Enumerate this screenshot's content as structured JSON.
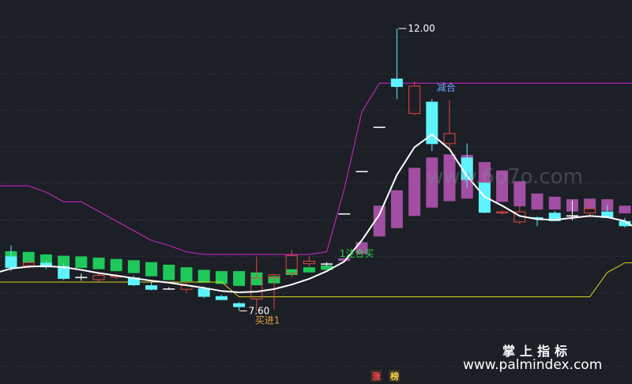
{
  "chart_data": {
    "type": "candlestick",
    "ylim": [
      7.2,
      12.1
    ],
    "grid": true,
    "candles": [
      {
        "o": 8.45,
        "h": 8.62,
        "l": 8.22,
        "c": 8.27
      },
      {
        "o": 8.3,
        "h": 8.4,
        "l": 8.26,
        "c": 8.36
      },
      {
        "o": 8.35,
        "h": 8.38,
        "l": 8.25,
        "c": 8.28
      },
      {
        "o": 8.3,
        "h": 8.34,
        "l": 8.08,
        "c": 8.1
      },
      {
        "o": 8.13,
        "h": 8.18,
        "l": 8.07,
        "c": 8.13
      },
      {
        "o": 8.08,
        "h": 8.18,
        "l": 8.06,
        "c": 8.16
      },
      {
        "o": 8.12,
        "h": 8.17,
        "l": 8.1,
        "c": 8.15
      },
      {
        "o": 8.12,
        "h": 8.15,
        "l": 7.99,
        "c": 8.0
      },
      {
        "o": 8.0,
        "h": 8.05,
        "l": 7.92,
        "c": 7.93
      },
      {
        "o": 7.95,
        "h": 7.97,
        "l": 7.93,
        "c": 7.95
      },
      {
        "o": 7.93,
        "h": 8.05,
        "l": 7.88,
        "c": 8.0
      },
      {
        "o": 7.95,
        "h": 7.98,
        "l": 7.8,
        "c": 7.82
      },
      {
        "o": 7.83,
        "h": 7.85,
        "l": 7.76,
        "c": 7.77
      },
      {
        "o": 7.72,
        "h": 7.74,
        "l": 7.6,
        "c": 7.66
      },
      {
        "o": 7.78,
        "h": 8.45,
        "l": 7.6,
        "c": 8.12
      },
      {
        "o": 8.11,
        "h": 8.14,
        "l": 7.62,
        "c": 8.17
      },
      {
        "o": 8.18,
        "h": 8.55,
        "l": 8.12,
        "c": 8.47
      },
      {
        "o": 8.33,
        "h": 8.45,
        "l": 8.29,
        "c": 8.38
      },
      {
        "o": 8.34,
        "h": 8.36,
        "l": 8.3,
        "c": 8.33
      },
      {
        "o": 9.12,
        "h": 9.12,
        "l": 9.12,
        "c": 9.12
      },
      {
        "o": 9.78,
        "h": 9.78,
        "l": 9.78,
        "c": 9.78
      },
      {
        "o": 10.47,
        "h": 10.47,
        "l": 10.47,
        "c": 10.47
      },
      {
        "o": 11.22,
        "h": 12.0,
        "l": 10.9,
        "c": 11.09
      },
      {
        "o": 10.67,
        "h": 11.17,
        "l": 10.65,
        "c": 11.11
      },
      {
        "o": 10.86,
        "h": 10.9,
        "l": 10.09,
        "c": 10.2
      },
      {
        "o": 10.2,
        "h": 10.88,
        "l": 10.1,
        "c": 10.37
      },
      {
        "o": 9.99,
        "h": 10.21,
        "l": 9.52,
        "c": 9.64
      },
      {
        "o": 9.6,
        "h": 9.6,
        "l": 9.12,
        "c": 9.13
      },
      {
        "o": 9.12,
        "h": 9.17,
        "l": 9.1,
        "c": 9.15
      },
      {
        "o": 8.98,
        "h": 9.25,
        "l": 8.95,
        "c": 9.15
      },
      {
        "o": 9.06,
        "h": 9.07,
        "l": 8.92,
        "c": 9.04
      },
      {
        "o": 9.13,
        "h": 9.16,
        "l": 9.0,
        "c": 9.0
      },
      {
        "o": 9.09,
        "h": 9.32,
        "l": 9.01,
        "c": 9.07
      },
      {
        "o": 9.12,
        "h": 9.32,
        "l": 9.05,
        "c": 9.2
      },
      {
        "o": 9.15,
        "h": 9.25,
        "l": 9.06,
        "c": 9.05
      },
      {
        "o": 9.0,
        "h": 9.05,
        "l": 8.9,
        "c": 8.92
      }
    ],
    "ma": [
      8.26,
      8.29,
      8.3,
      8.28,
      8.24,
      8.19,
      8.15,
      8.11,
      8.07,
      8.04,
      8.0,
      7.96,
      7.91,
      7.89,
      7.9,
      7.94,
      8.01,
      8.1,
      8.22,
      8.37,
      8.7,
      9.1,
      9.72,
      10.15,
      10.35,
      10.12,
      9.7,
      9.38,
      9.24,
      9.08,
      9.03,
      9.02,
      9.05,
      9.08,
      9.06,
      9.0
    ],
    "lower_band": [
      8.05,
      8.05,
      8.05,
      8.05,
      8.05,
      8.05,
      8.05,
      8.05,
      8.05,
      8.05,
      8.05,
      8.05,
      8.05,
      7.82,
      7.82,
      7.82,
      7.82,
      7.82,
      7.82,
      7.82,
      7.82,
      7.82,
      7.82,
      7.82,
      7.82,
      7.82,
      7.82,
      7.82,
      7.82,
      7.82,
      7.82,
      7.82,
      7.82,
      7.82,
      8.2,
      8.35
    ],
    "upper_band": [
      9.55,
      9.55,
      9.45,
      9.3,
      9.3,
      9.15,
      9.0,
      8.85,
      8.7,
      8.62,
      8.52,
      8.48,
      8.48,
      8.48,
      8.48,
      8.48,
      8.48,
      8.48,
      8.52,
      9.5,
      10.7,
      11.15,
      11.15,
      11.15,
      11.15,
      11.15,
      11.15,
      11.15,
      11.15,
      11.15,
      11.15,
      11.15,
      11.15,
      11.15,
      11.15,
      11.15
    ],
    "momentum_bars": [
      {
        "low": 8.3,
        "high": 8.53,
        "color": "#1ec95a"
      },
      {
        "low": 8.35,
        "high": 8.52,
        "color": "#1ec95a"
      },
      {
        "low": 8.33,
        "high": 8.48,
        "color": "#1ec95a"
      },
      {
        "low": 8.3,
        "high": 8.46,
        "color": "#1ec95a"
      },
      {
        "low": 8.27,
        "high": 8.45,
        "color": "#1ec95a"
      },
      {
        "low": 8.25,
        "high": 8.43,
        "color": "#1ec95a"
      },
      {
        "low": 8.22,
        "high": 8.41,
        "color": "#1ec95a"
      },
      {
        "low": 8.19,
        "high": 8.39,
        "color": "#1ec95a"
      },
      {
        "low": 8.14,
        "high": 8.36,
        "color": "#1ec95a"
      },
      {
        "low": 8.08,
        "high": 8.32,
        "color": "#1ec95a"
      },
      {
        "low": 8.06,
        "high": 8.28,
        "color": "#1ec95a"
      },
      {
        "low": 8.04,
        "high": 8.24,
        "color": "#1ec95a"
      },
      {
        "low": 8.02,
        "high": 8.22,
        "color": "#1ec95a"
      },
      {
        "low": 7.99,
        "high": 8.22,
        "color": "#1ec95a"
      },
      {
        "low": 8.0,
        "high": 8.2,
        "color": "#1ec95a"
      },
      {
        "low": 8.03,
        "high": 8.14,
        "color": "#1ec95a"
      },
      {
        "low": 8.16,
        "high": 8.25,
        "color": "#1ec95a"
      },
      {
        "low": 8.2,
        "high": 8.28,
        "color": "#1ec95a"
      },
      {
        "low": 8.24,
        "high": 8.31,
        "color": "#1ec95a"
      },
      {
        "low": 8.38,
        "high": 8.42,
        "color": "#a24ea3"
      },
      {
        "low": 8.49,
        "high": 8.67,
        "color": "#a24ea3"
      },
      {
        "low": 8.76,
        "high": 9.24,
        "color": "#a24ea3"
      },
      {
        "low": 8.89,
        "high": 9.48,
        "color": "#a24ea3"
      },
      {
        "low": 9.08,
        "high": 9.83,
        "color": "#a24ea3"
      },
      {
        "low": 9.21,
        "high": 9.99,
        "color": "#a24ea3"
      },
      {
        "low": 9.31,
        "high": 10.04,
        "color": "#a24ea3"
      },
      {
        "low": 9.35,
        "high": 10.03,
        "color": "#a24ea3"
      },
      {
        "low": 9.34,
        "high": 9.92,
        "color": "#a24ea3"
      },
      {
        "low": 9.3,
        "high": 9.79,
        "color": "#a24ea3"
      },
      {
        "low": 9.23,
        "high": 9.62,
        "color": "#a24ea3"
      },
      {
        "low": 9.18,
        "high": 9.43,
        "color": "#a24ea3"
      },
      {
        "low": 9.18,
        "high": 9.38,
        "color": "#a24ea3"
      },
      {
        "low": 9.15,
        "high": 9.34,
        "color": "#a24ea3"
      },
      {
        "low": 9.19,
        "high": 9.35,
        "color": "#a24ea3"
      },
      {
        "low": 9.16,
        "high": 9.34,
        "color": "#a24ea3"
      },
      {
        "low": 9.12,
        "high": 9.24,
        "color": "#a24ea3"
      }
    ],
    "annotations": {
      "high": {
        "label": "12.00",
        "index": 22,
        "value": 12.0
      },
      "low": {
        "label": "7.60",
        "index": 13,
        "value": 7.6
      },
      "buy": {
        "label": "买进1",
        "index": 14,
        "value": 7.6
      },
      "add": {
        "label": "1注合买",
        "index": 19,
        "value": 8.42
      },
      "reduce": {
        "label": "减合",
        "index": 24,
        "value": 11.03
      }
    },
    "colors": {
      "up": "#e04a3f",
      "down": "#5ef3ff",
      "doji": "#ffffff",
      "ma": "#ffffff",
      "upper_band": "#d326d3",
      "lower_band": "#d6d61e",
      "grid": "#3a3f4a",
      "background": "#1c1f26"
    }
  },
  "watermark": {
    "brand_cn": "掌上指标",
    "site": "www.palmindex.com",
    "faded": "www.6o7o.com"
  },
  "badges": [
    {
      "text": "涨",
      "color": "#ff4a4a"
    },
    {
      "text": "榜",
      "color": "#ffd24a"
    }
  ]
}
